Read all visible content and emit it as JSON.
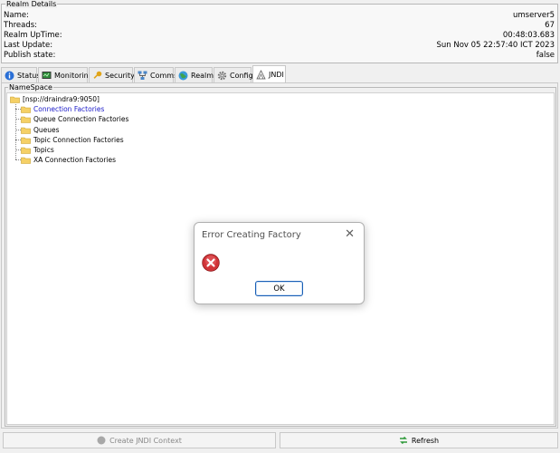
{
  "realm_details": {
    "legend": "Realm Details",
    "rows": [
      {
        "label": "Name:",
        "value": "umserver5"
      },
      {
        "label": "Threads:",
        "value": "67"
      },
      {
        "label": "Realm UpTime:",
        "value": "00:48:03.683"
      },
      {
        "label": "Last Update:",
        "value": "Sun Nov 05 22:57:40 ICT 2023"
      },
      {
        "label": "Publish state:",
        "value": "false"
      }
    ]
  },
  "tabs": [
    {
      "label": "Status",
      "icon": "info-icon"
    },
    {
      "label": "Monitoring",
      "icon": "monitor-icon"
    },
    {
      "label": "Security",
      "icon": "key-icon"
    },
    {
      "label": "Comms",
      "icon": "network-icon"
    },
    {
      "label": "Realms",
      "icon": "globe-icon"
    },
    {
      "label": "Config",
      "icon": "gear-icon"
    },
    {
      "label": "JNDI",
      "icon": "jndi-icon",
      "active": true
    }
  ],
  "namespace": {
    "legend": "NameSpace",
    "root": "[nsp://draindra9:9050]",
    "children": [
      "Connection Factories",
      "Queue Connection Factories",
      "Queues",
      "Topic Connection Factories",
      "Topics",
      "XA Connection Factories"
    ],
    "selected_index": 0
  },
  "dialog": {
    "title": "Error Creating Factory",
    "close": "✕",
    "ok_label": "OK"
  },
  "buttons": {
    "create_label": "Create JNDI Context",
    "refresh_label": "Refresh"
  },
  "colors": {
    "selected_text": "#1a1ac8",
    "error_red": "#d13438",
    "folder": "#f5d066",
    "ok_border": "#1a5fb4"
  }
}
